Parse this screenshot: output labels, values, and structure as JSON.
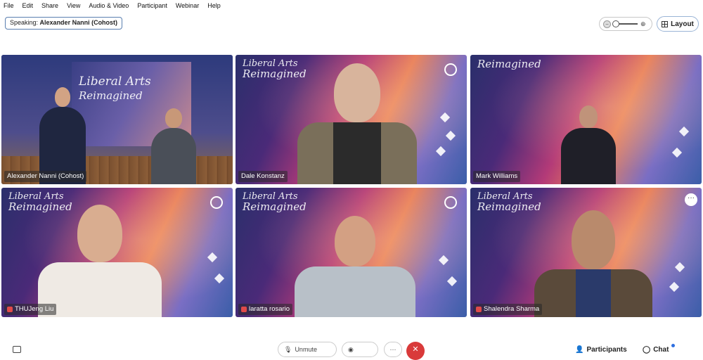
{
  "menu": [
    "File",
    "Edit",
    "Share",
    "View",
    "Audio & Video",
    "Participant",
    "Webinar",
    "Help"
  ],
  "speaking": {
    "prefix": "Speaking:",
    "name": "Alexander Nanni (Cohost)"
  },
  "toolbar": {
    "layout_label": "Layout",
    "zoom_minus": "−",
    "zoom_plus": "⊕"
  },
  "tile_more": "···",
  "branding": {
    "line1": "Liberal Arts",
    "line2": "Reimagined"
  },
  "participants": [
    {
      "name": "Alexander Nanni (Cohost)",
      "muted": false
    },
    {
      "name": "Dale Konstanz",
      "muted": false
    },
    {
      "name": "Mark Williams",
      "muted": false
    },
    {
      "name": "THUJeng Liu",
      "muted": true
    },
    {
      "name": "laratta rosario",
      "muted": true
    },
    {
      "name": "Shalendra Sharma",
      "muted": true
    }
  ],
  "bottom": {
    "unmute": "Unmute",
    "more": "···",
    "end": "✕",
    "participants": "Participants",
    "chat": "Chat"
  },
  "colors": {
    "mute_red": "#e04a4a",
    "end_red": "#d93a3a",
    "accent_blue": "#2f6fe0"
  }
}
